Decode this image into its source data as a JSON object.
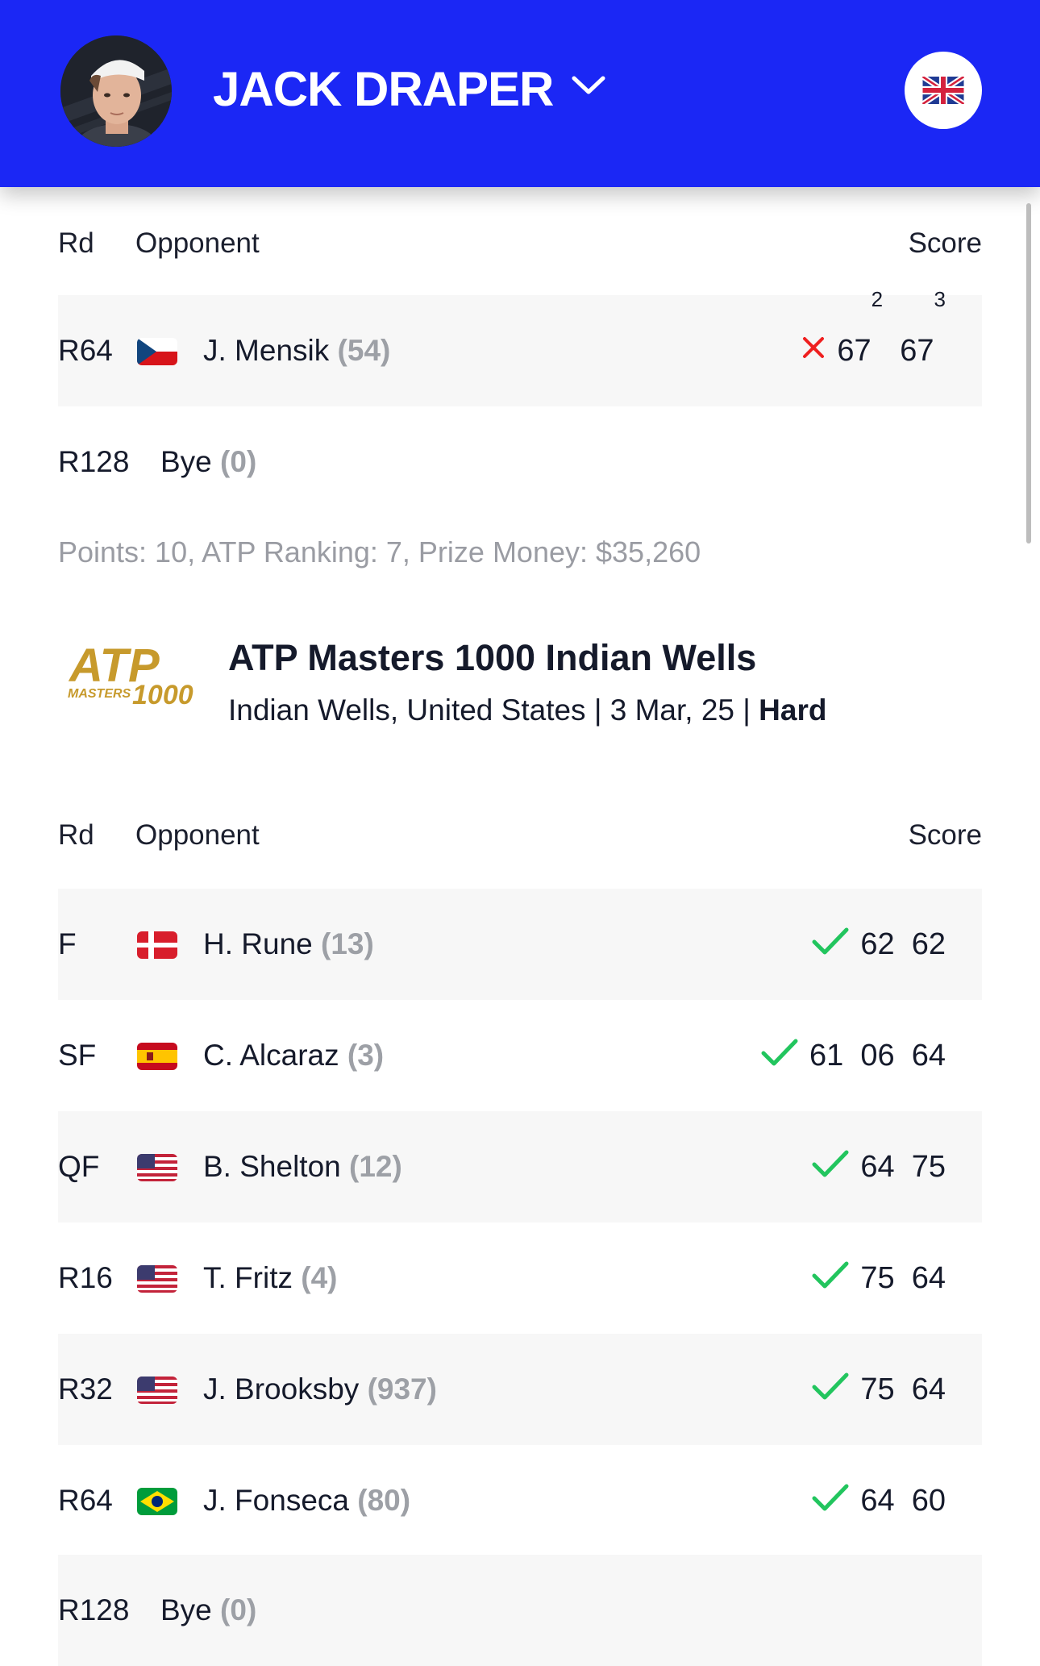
{
  "header": {
    "player_name": "JACK DRAPER",
    "country_flag_icon": "uk-flag-icon",
    "background_color": "#1b27f5"
  },
  "section1": {
    "columns": {
      "rd": "Rd",
      "opponent": "Opponent",
      "score": "Score"
    },
    "rows": [
      {
        "rd": "R64",
        "flag": "czech-flag",
        "name": "J. Mensik",
        "seed": "(54)",
        "result": "loss",
        "sets": [
          {
            "g": "67",
            "tb": "2"
          },
          {
            "g": "67",
            "tb": "3"
          }
        ]
      },
      {
        "rd": "R128",
        "name": "Bye",
        "seed": "(0)"
      }
    ],
    "summary": "Points: 10, ATP Ranking: 7, Prize Money: $35,260"
  },
  "tournament": {
    "logo_text_main": "ATP",
    "logo_text_sub": "MASTERS",
    "logo_text_num": "1000",
    "title": "ATP Masters 1000 Indian Wells",
    "location_date": "Indian Wells, United States | 3 Mar, 25 |",
    "surface": "Hard"
  },
  "section2": {
    "columns": {
      "rd": "Rd",
      "opponent": "Opponent",
      "score": "Score"
    },
    "rows": [
      {
        "rd": "F",
        "flag": "denmark-flag",
        "name": "H. Rune",
        "seed": "(13)",
        "result": "win",
        "score": "62  62"
      },
      {
        "rd": "SF",
        "flag": "spain-flag",
        "name": "C. Alcaraz",
        "seed": "(3)",
        "result": "win",
        "score": "61  06  64"
      },
      {
        "rd": "QF",
        "flag": "usa-flag",
        "name": "B. Shelton",
        "seed": "(12)",
        "result": "win",
        "score": "64  75"
      },
      {
        "rd": "R16",
        "flag": "usa-flag",
        "name": "T. Fritz",
        "seed": "(4)",
        "result": "win",
        "score": "75  64"
      },
      {
        "rd": "R32",
        "flag": "usa-flag",
        "name": "J. Brooksby",
        "seed": "(937)",
        "result": "win",
        "score": "75  64"
      },
      {
        "rd": "R64",
        "flag": "brazil-flag",
        "name": "J. Fonseca",
        "seed": "(80)",
        "result": "win",
        "score": "64  60"
      },
      {
        "rd": "R128",
        "name": "Bye",
        "seed": "(0)"
      }
    ]
  },
  "colors": {
    "win": "#22c55e",
    "loss": "#ef2020",
    "seed": "#9da0a6"
  }
}
